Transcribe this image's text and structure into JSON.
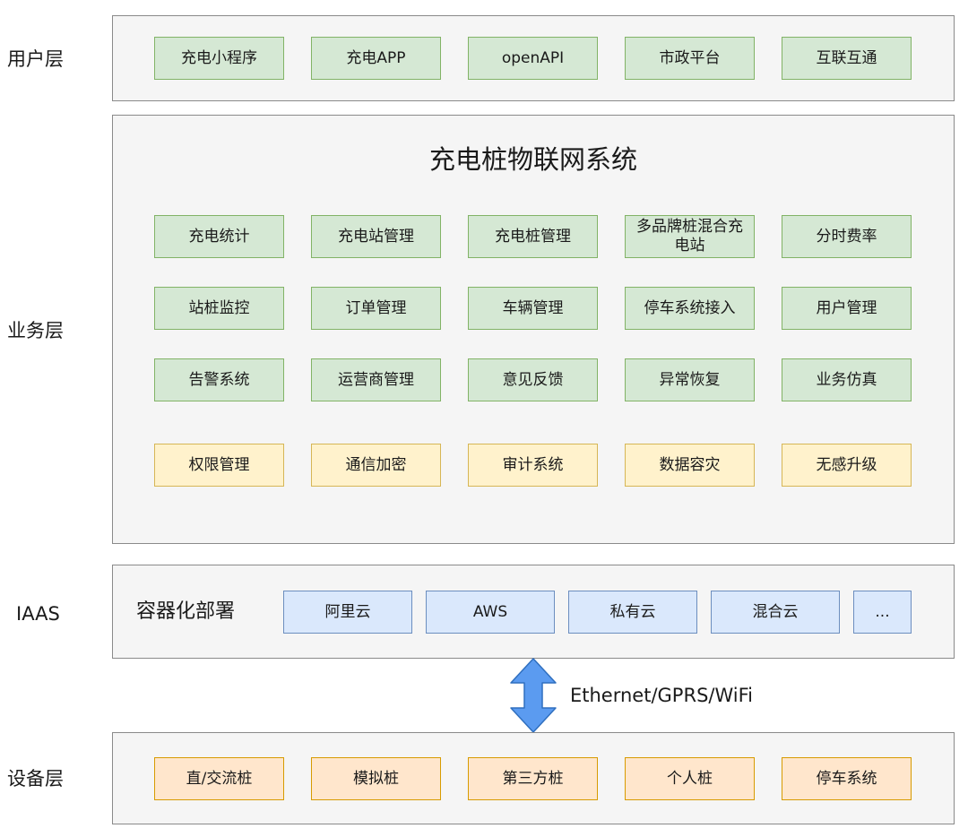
{
  "layers": {
    "user": "用户层",
    "business": "业务层",
    "iaas": "IAAS",
    "device": "设备层"
  },
  "user_layer": [
    "充电小程序",
    "充电APP",
    "openAPI",
    "市政平台",
    "互联互通"
  ],
  "business_layer": {
    "title": "充电桩物联网系统",
    "rows": [
      [
        "充电统计",
        "充电站管理",
        "充电桩管理",
        "多品牌桩混合充电站",
        "分时费率"
      ],
      [
        "站桩监控",
        "订单管理",
        "车辆管理",
        "停车系统接入",
        "用户管理"
      ],
      [
        "告警系统",
        "运营商管理",
        "意见反馈",
        "异常恢复",
        "业务仿真"
      ]
    ],
    "security_row": [
      "权限管理",
      "通信加密",
      "审计系统",
      "数据容灾",
      "无感升级"
    ]
  },
  "iaas_layer": {
    "label": "容器化部署",
    "clouds": [
      "阿里云",
      "AWS",
      "私有云",
      "混合云",
      "..."
    ]
  },
  "connection": {
    "label": "Ethernet/GPRS/WiFi"
  },
  "device_layer": [
    "直/交流桩",
    "模拟桩",
    "第三方桩",
    "个人桩",
    "停车系统"
  ],
  "colors": {
    "panel_fill": "#f5f5f5",
    "green_fill": "#d5e8d4",
    "yellow_fill": "#fff2cc",
    "blue_fill": "#dae8fc",
    "orange_fill": "#ffe6cc",
    "arrow_fill": "#5b9bf0"
  }
}
